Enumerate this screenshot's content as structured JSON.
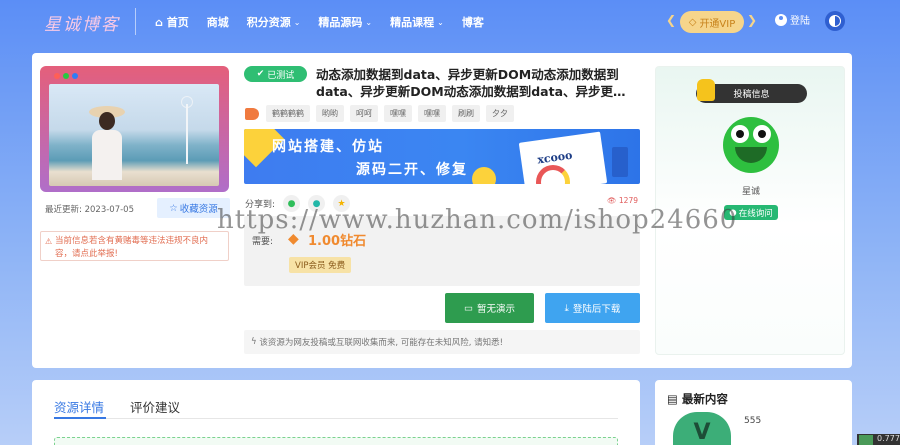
{
  "header": {
    "logo": "星诚博客",
    "nav": [
      {
        "label": "首页",
        "icon": "home-icon",
        "dropdown": false
      },
      {
        "label": "商城",
        "dropdown": false
      },
      {
        "label": "积分资源",
        "dropdown": true
      },
      {
        "label": "精品源码",
        "dropdown": true
      },
      {
        "label": "精品课程",
        "dropdown": true
      },
      {
        "label": "博客",
        "dropdown": false
      }
    ],
    "vip_label": "开通VIP",
    "login_label": "登陆"
  },
  "product": {
    "update_label": "最近更新",
    "update_date": "2023-07-05",
    "favorite_label": "收藏资源",
    "notice": "当前信息若含有黄赌毒等违法违规不良内容，请点此举报!",
    "status_badge": "已测试",
    "title": "动态添加数据到data、异步更新DOM动态添加数据到data、异步更新DOM动态添加数据到data、异步更新DOM",
    "tags": [
      "鹤鹤鹤鹤",
      "哟哟",
      "呵呵",
      "嘿嘿",
      "嘿嘿",
      "刷刷",
      "夕夕"
    ],
    "banner": {
      "line1": "网站搭建、仿站",
      "line2": "源码二开、修复",
      "brand": "xcooo"
    },
    "share_label": "分享到:",
    "views": "1279",
    "price_label": "需要:",
    "price": "1.00钻石",
    "vip_free": "VIP会员 免费",
    "demo_button": "暂无演示",
    "download_button": "登陆后下载",
    "disclaimer": "该资源为网友投稿或互联网收集而来, 可能存在未知风险, 请知悉!"
  },
  "author": {
    "section_label": "投稿信息",
    "name": "星诚",
    "chat_label": "在线询问"
  },
  "details": {
    "tabs": [
      "资源详情",
      "评价建议"
    ]
  },
  "latest": {
    "title": "最新内容",
    "first_count": "555"
  },
  "watermark": "https://www.huzhan.com/ishop24660",
  "corner_label": "0.777",
  "colors": {
    "accent": "#3778e3",
    "green": "#2fbe73",
    "price": "#f08a2f",
    "vip": "#f6d58b"
  }
}
